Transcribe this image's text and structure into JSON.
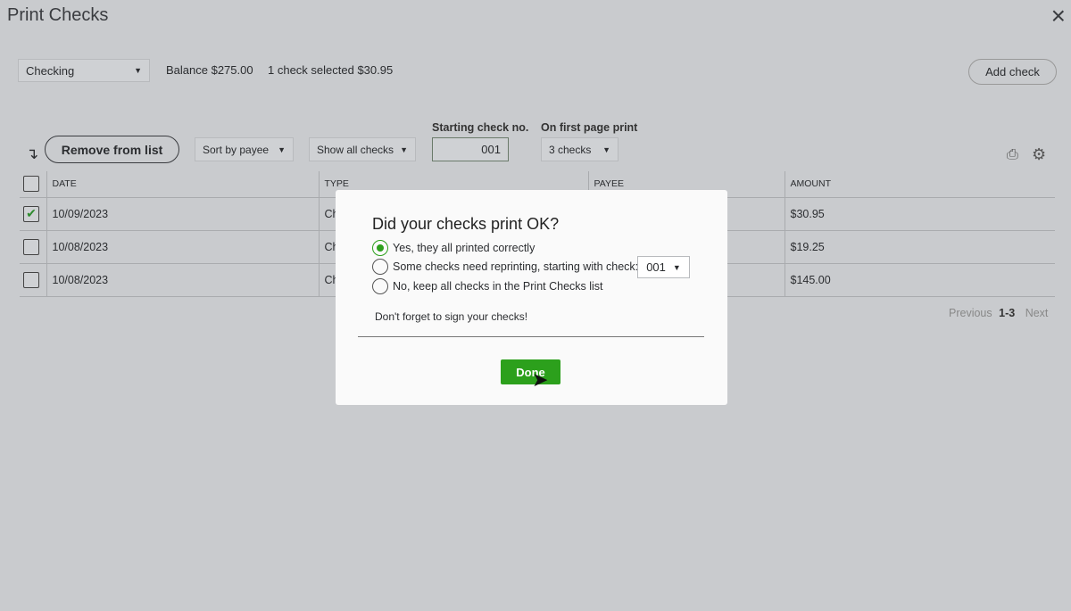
{
  "window": {
    "title": "Print Checks",
    "close_icon": "×"
  },
  "account": {
    "selected": "Checking"
  },
  "balance": "Balance  $275.00",
  "selection": "1 check selected  $30.95",
  "add_check": "Add check",
  "toolbar": {
    "remove": "Remove from list",
    "sort": "Sort by payee",
    "filter": "Show all checks",
    "start_label": "Starting check no.",
    "start_value": "001",
    "first_page_label": "On first page print",
    "first_page_value": "3 checks"
  },
  "table": {
    "headers": [
      "DATE",
      "TYPE",
      "PAYEE",
      "AMOUNT"
    ],
    "rows": [
      {
        "checked": true,
        "date": "10/09/2023",
        "type": "Check",
        "amount": "$30.95"
      },
      {
        "checked": false,
        "date": "10/08/2023",
        "type": "Check",
        "amount": "$19.25"
      },
      {
        "checked": false,
        "date": "10/08/2023",
        "type": "Check",
        "amount": "$145.00"
      }
    ]
  },
  "pagination": {
    "previous": "Previous",
    "range": "1-3",
    "next": "Next"
  },
  "modal": {
    "title": "Did your checks print OK?",
    "options": [
      "Yes, they all printed correctly",
      "Some checks need reprinting, starting with check:",
      "No, keep all checks in the Print Checks list"
    ],
    "selected_option": 0,
    "reprint_value": "001",
    "reminder": "Don't forget to sign your checks!",
    "done": "Done"
  },
  "colors": {
    "accent": "#2ca01c"
  }
}
